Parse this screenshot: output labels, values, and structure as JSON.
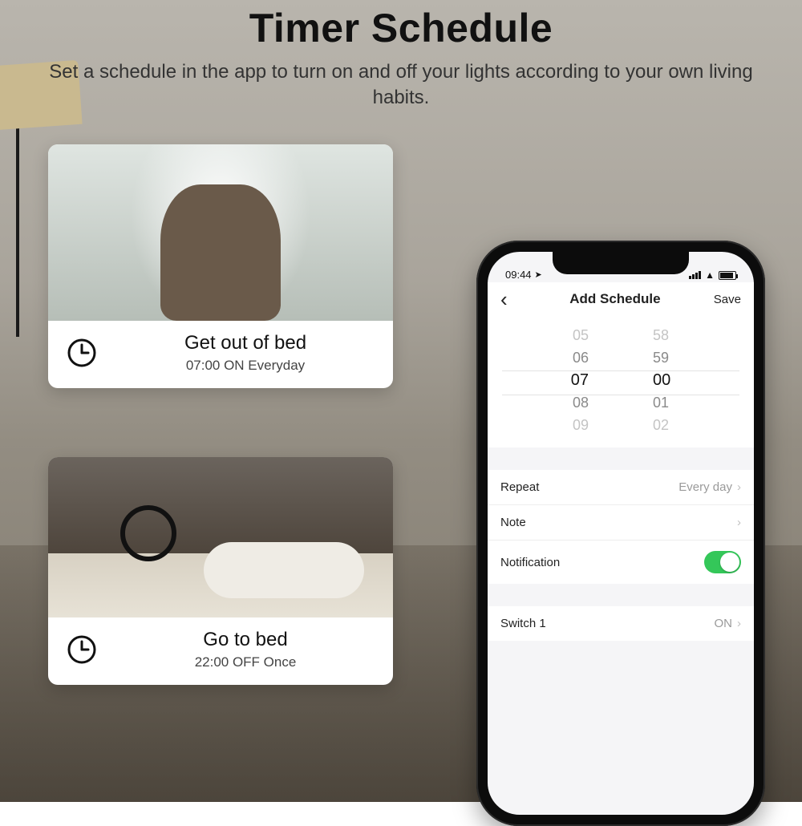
{
  "hero": {
    "title": "Timer Schedule",
    "subtitle": "Set a schedule in the app to turn on and off your lights according to your own living habits."
  },
  "cards": [
    {
      "title": "Get out of bed",
      "subtitle": "07:00 ON Everyday"
    },
    {
      "title": "Go to bed",
      "subtitle": "22:00 OFF Once"
    }
  ],
  "phone": {
    "statusbar": {
      "time": "09:44",
      "loc_icon": "➤"
    },
    "nav": {
      "back": "‹",
      "title": "Add Schedule",
      "save": "Save"
    },
    "picker": {
      "hours": [
        "05",
        "06",
        "07",
        "08",
        "09"
      ],
      "minutes": [
        "58",
        "59",
        "00",
        "01",
        "02"
      ]
    },
    "rows": {
      "repeat": {
        "label": "Repeat",
        "value": "Every day"
      },
      "note": {
        "label": "Note",
        "value": ""
      },
      "notification": {
        "label": "Notification",
        "on": true
      },
      "switch1": {
        "label": "Switch 1",
        "value": "ON"
      }
    }
  }
}
